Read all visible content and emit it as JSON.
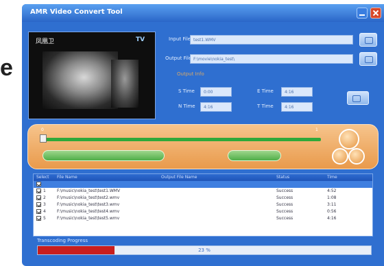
{
  "side_text": "e",
  "window": {
    "title": "AMR Video Convert Tool",
    "minimize_icon": "minimize-icon",
    "close_icon": "close-icon"
  },
  "preview": {
    "logo_text": "凤凰卫",
    "channel_text": "TV"
  },
  "files": {
    "input_label": "Input File",
    "input_value": "test1.WMV",
    "output_label": "Output File",
    "output_value": "F:\\movie\\nokia_test\\"
  },
  "options": {
    "group_label": "Output Info",
    "s_time_label": "S Time",
    "s_time_value": "0:00",
    "e_time_label": "E Time",
    "e_time_value": "4:16",
    "n_time_label": "N Time",
    "n_time_value": "4:16",
    "t_time_label": "T Time",
    "t_time_value": "4:16"
  },
  "slider": {
    "start_label": "0",
    "end_label": "1",
    "position": 0.0
  },
  "table": {
    "headers": [
      "Select",
      "File Name",
      "Output File Name",
      "Status",
      "Time"
    ],
    "rows": [
      {
        "checked": true,
        "num": "",
        "file": "",
        "status": "",
        "time": "",
        "selected": true
      },
      {
        "checked": true,
        "num": "1",
        "file": "F:\\music\\nokia_test\\test1.WMV",
        "status": "Success",
        "time": "4:52"
      },
      {
        "checked": true,
        "num": "2",
        "file": "F:\\music\\nokia_test\\test2.wmv",
        "status": "Success",
        "time": "1:08"
      },
      {
        "checked": true,
        "num": "3",
        "file": "F:\\music\\nokia_test\\test3.wmv",
        "status": "Success",
        "time": "3:11"
      },
      {
        "checked": true,
        "num": "4",
        "file": "F:\\music\\nokia_test\\test4.wmv",
        "status": "Success",
        "time": "0:56"
      },
      {
        "checked": true,
        "num": "5",
        "file": "F:\\music\\nokia_test\\test5.wmv",
        "status": "Success",
        "time": "4:16"
      }
    ]
  },
  "transcoding": {
    "label": "Transcoding Progress",
    "percent_text": "23 %",
    "fraction": 0.23
  },
  "colors": {
    "window_bg": "#2f6fd0",
    "panel_orange": "#e99a4c",
    "progress_red": "#c81e1e",
    "slider_green": "#2fa83a"
  }
}
